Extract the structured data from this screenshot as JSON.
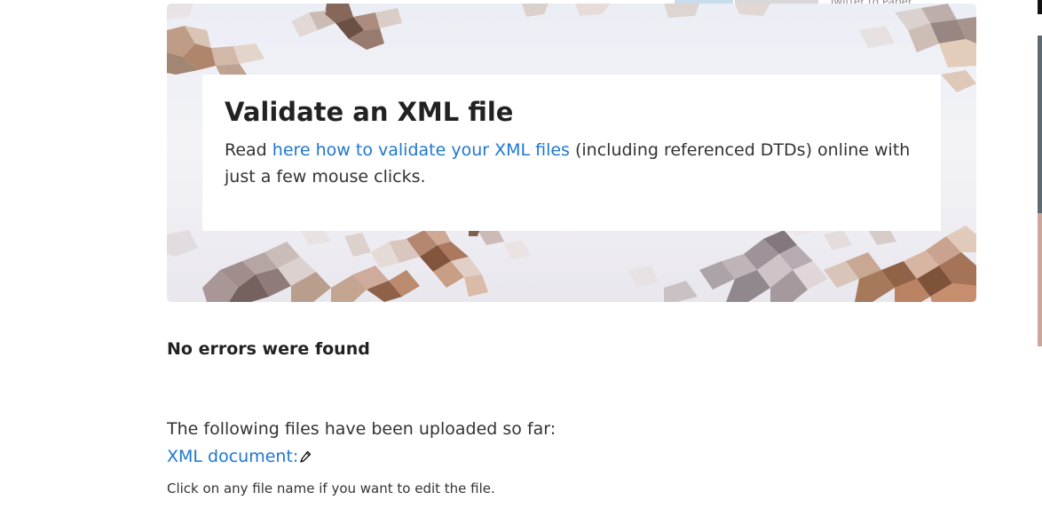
{
  "top_strip": {
    "cut_text": "Twitter to Paper..."
  },
  "hero": {
    "title": "Validate an XML file",
    "text_prefix": "Read ",
    "link_text": "here how to validate your XML files",
    "text_suffix": " (including referenced DTDs) online with just a few mouse clicks."
  },
  "result": {
    "status": "No errors were found"
  },
  "files": {
    "intro": "The following files have been uploaded so far:",
    "items": [
      {
        "label": "XML document:",
        "icon": "pencil-icon"
      }
    ],
    "note": "Click on any file name if you want to edit the file."
  },
  "colors": {
    "link": "#1f77d0",
    "text": "#222222"
  }
}
